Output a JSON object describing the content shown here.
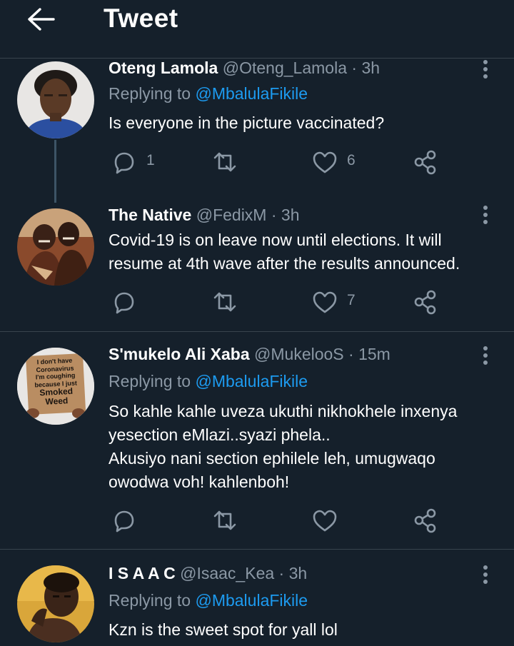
{
  "header": {
    "title": "Tweet"
  },
  "tweets": [
    {
      "name": "Oteng Lamola",
      "handle": "@Oteng_Lamola",
      "sep": "·",
      "time": "3h",
      "replying_prefix": "Replying to",
      "replying_to": "@MbalulaFikile",
      "text": "Is everyone in the picture vaccinated?",
      "reply_count": "1",
      "retweet_count": "",
      "like_count": "6"
    },
    {
      "name": "The Native",
      "handle": "@FedixM",
      "sep": "·",
      "time": "3h",
      "text_lines": [
        "Covid-19 is on leave now until elections.  It will",
        "resume at 4th wave after the results announced."
      ],
      "reply_count": "",
      "retweet_count": "",
      "like_count": "7"
    },
    {
      "name": "S'mukelo Ali Xaba",
      "handle": "@MukelooS",
      "sep": "·",
      "time": "15m",
      "replying_prefix": "Replying to",
      "replying_to": "@MbalulaFikile",
      "text_lines": [
        "So kahle kahle uveza ukuthi nikhokhele inxenya",
        "yesection eMlazi..syazi phela..",
        "Akusiyo nani section ephilele leh, umugwaqo",
        "owodwa voh! kahlenboh!"
      ],
      "avatar_sign": [
        "I don't have",
        "Coronavirus",
        "I'm coughing",
        "because I just",
        "Smoked",
        "Weed"
      ],
      "reply_count": "",
      "retweet_count": "",
      "like_count": ""
    },
    {
      "name": "I S A A C",
      "handle": "@Isaac_Kea",
      "sep": "·",
      "time": "3h",
      "replying_prefix": "Replying to",
      "replying_to": "@MbalulaFikile",
      "text": "Kzn is the sweet spot for yall lol"
    }
  ],
  "icons": {
    "back": "arrow-left-icon",
    "reply": "reply-icon",
    "retweet": "retweet-icon",
    "like": "heart-icon",
    "share": "share-icon",
    "more": "more-vertical-icon"
  },
  "colors": {
    "background": "#15202b",
    "text": "#ffffff",
    "muted": "#8b98a5",
    "accent": "#1d9bf0",
    "divider": "#38444d"
  }
}
